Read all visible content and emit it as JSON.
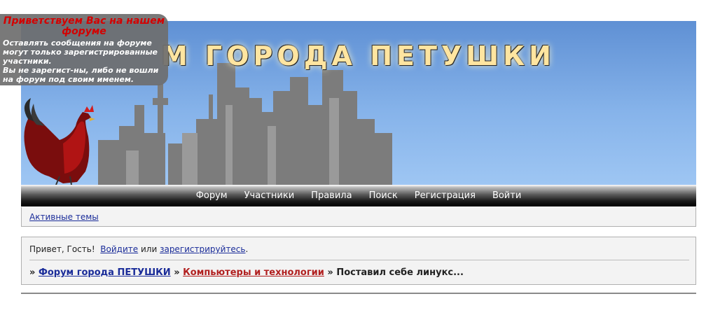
{
  "header": {
    "title": "М ГОРОДА ПЕТУШКИ"
  },
  "welcome": {
    "title": "Приветствуем Вас на нашем форуме",
    "text": "Оставлять сообщения на форуме\nмогут только зарегистрированные\nучастники.\nВы не зарегист-ны, либо не вошли\nна форум под своим именем."
  },
  "nav": {
    "items": [
      {
        "label": "Форум"
      },
      {
        "label": "Участники"
      },
      {
        "label": "Правила"
      },
      {
        "label": "Поиск"
      },
      {
        "label": "Регистрация"
      },
      {
        "label": "Войти"
      }
    ]
  },
  "active_topics": {
    "label": "Активные темы"
  },
  "greeting": {
    "prefix": "Привет, Гость!",
    "login_link": "Войдите",
    "or": "или",
    "register_link": "зарегистрируйтесь",
    "suffix": "."
  },
  "breadcrumb": {
    "sep": "»",
    "forum": "Форум города ПЕТУШКИ",
    "category": "Компьютеры и технологии",
    "topic": "Поставил себе линукс..."
  },
  "colors": {
    "sky_top": "#5f90d4",
    "link": "#1a2c99",
    "category_link": "#b11f1f",
    "welcome_title": "#d40000"
  }
}
